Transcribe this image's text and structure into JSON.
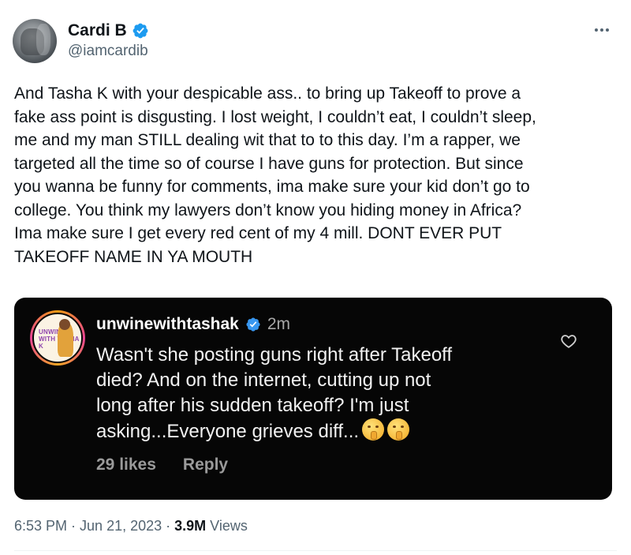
{
  "author": {
    "display_name": "Cardi B",
    "handle": "@iamcardib",
    "verified": true
  },
  "tweet": {
    "lines": [
      "And Tasha K with your despicable ass.. to bring up Takeoff to prove a",
      "fake ass point is disgusting. I lost weight, I couldn’t eat, I couldn’t sleep,",
      "me and my man STILL dealing wit that to to this day. I’m a rapper, we",
      "targeted all the time so of course I have guns for protection. But since",
      "you wanna be funny for comments, ima make sure your kid don’t go to",
      "college. You think my lawyers don’t know you hiding money in Africa?",
      "Ima make sure I get every red cent of my 4 mill. DONT EVER PUT",
      "TAKEOFF NAME IN YA MOUTH"
    ]
  },
  "quoted_comment": {
    "username": "unwinewithtashak",
    "time": "2m",
    "avatar_text": "UNWINE WITH TASHA K",
    "lines": [
      "Wasn't she posting guns right after Takeoff",
      "died? And on the internet, cutting up not",
      "long after his sudden takeoff? I'm just",
      "asking...Everyone grieves diff..."
    ],
    "emojis": [
      "shushing-face",
      "shushing-face"
    ],
    "likes_label": "29 likes",
    "reply_label": "Reply"
  },
  "meta": {
    "time": "6:53 PM",
    "separator": " · ",
    "date": "Jun 21, 2023",
    "views_count": "3.9M",
    "views_label": " Views"
  },
  "colors": {
    "verified_blue": "#1d9bf0",
    "secondary_text": "#536471",
    "card_background": "#060606"
  }
}
